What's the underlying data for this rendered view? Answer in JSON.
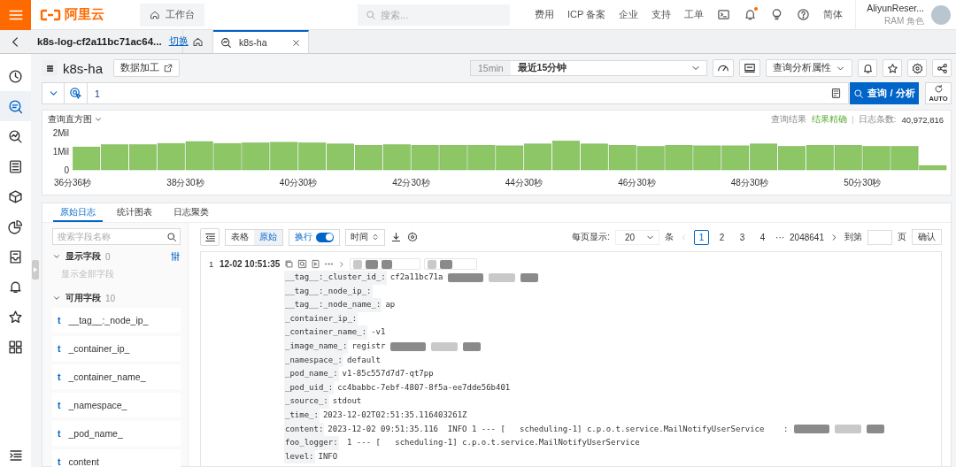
{
  "topbar": {
    "logo": "阿里云",
    "workbench": "工作台",
    "search_placeholder": "搜索...",
    "links": [
      "费用",
      "ICP 备案",
      "企业",
      "支持",
      "工单"
    ],
    "language": "简体",
    "user": {
      "name": "AliyunReser...",
      "role": "RAM 角色"
    }
  },
  "project_bar": {
    "project": "k8s-log-cf2a11bc71ac64...",
    "switch_link": "切换",
    "tabs": [
      {
        "kind": "home",
        "selected": false
      },
      {
        "kind": "logstore",
        "label": "k8s-ha",
        "selected": true
      }
    ]
  },
  "sidebar": {
    "items": [
      {
        "kind": "clock",
        "selected": false
      },
      {
        "kind": "search",
        "selected": true
      },
      {
        "kind": "search-chart",
        "selected": false
      },
      {
        "kind": "list",
        "selected": false
      },
      {
        "kind": "box",
        "selected": false
      },
      {
        "kind": "pie",
        "selected": false
      },
      {
        "kind": "inbox",
        "selected": false
      },
      {
        "kind": "bell",
        "selected": false
      },
      {
        "kind": "star",
        "selected": false
      },
      {
        "kind": "grid",
        "selected": false
      }
    ]
  },
  "logstore": {
    "title": "k8s-ha",
    "data_process_button": "数据加工",
    "time_range": {
      "badge": "15min",
      "label": "最近15分钟"
    },
    "query_properties": "查询分析属性"
  },
  "query": {
    "value": "1",
    "search_button": "查询 / 分析",
    "auto_label": "AUTO"
  },
  "histogram": {
    "title": "查询直方图",
    "result_label": "查询结果",
    "result_status": "结果精确",
    "count_label": "日志条数:",
    "count": "40,972,816",
    "chart_data": {
      "type": "bar",
      "ylim": [
        0,
        2
      ],
      "yticks": [
        0,
        {
          "value": 1,
          "label": "1Mil"
        },
        {
          "value": 2,
          "label": "2Mil"
        }
      ],
      "categories": [
        "36分36秒",
        null,
        null,
        null,
        "38分30秒",
        null,
        null,
        null,
        "40分30秒",
        null,
        null,
        null,
        "42分30秒",
        null,
        null,
        null,
        "44分30秒",
        null,
        null,
        null,
        "46分30秒",
        null,
        null,
        null,
        "48分30秒",
        null,
        null,
        null,
        "50分30秒",
        null,
        null
      ],
      "series": [
        {
          "color": "#8cc665",
          "values": [
            1.23,
            1.35,
            1.35,
            1.42,
            1.52,
            1.42,
            1.45,
            1.48,
            1.45,
            1.39,
            1.32,
            1.35,
            1.32,
            1.32,
            1.32,
            1.29,
            1.39,
            1.55,
            1.39,
            1.32,
            1.26,
            1.32,
            1.29,
            1.29,
            1.39,
            1.26,
            1.32,
            1.32,
            1.26,
            1.26,
            0.23
          ]
        }
      ]
    }
  },
  "result_tabs": [
    {
      "label": "原始日志",
      "selected": true
    },
    {
      "label": "统计图表",
      "selected": false
    },
    {
      "label": "日志聚类",
      "selected": false
    }
  ],
  "fields_panel": {
    "search_placeholder": "搜索字段名称",
    "shown": {
      "label": "显示字段",
      "count": "0",
      "expanded": true
    },
    "show_all": {
      "label": "显示全部字段",
      "disabled": true
    },
    "available": {
      "label": "可用字段",
      "count": "10",
      "expanded": true
    },
    "fields": [
      {
        "type": "t",
        "name": "__tag__:_node_ip_"
      },
      {
        "type": "t",
        "name": "_container_ip_"
      },
      {
        "type": "t",
        "name": "_container_name_"
      },
      {
        "type": "t",
        "name": "_namespace_"
      },
      {
        "type": "t",
        "name": "_pod_name_"
      },
      {
        "type": "t",
        "name": "content"
      }
    ]
  },
  "log_toolbar": {
    "view_modes": [
      {
        "label": "表格",
        "selected": false
      },
      {
        "label": "原始",
        "selected": true
      }
    ],
    "wrap": {
      "label": "换行",
      "on": true
    },
    "sort": "时间"
  },
  "pagination": {
    "per_page_label": "每页显示:",
    "per_page": "20",
    "unit": "条",
    "pages": [
      {
        "label": "1",
        "selected": true
      },
      {
        "label": "2",
        "selected": false
      },
      {
        "label": "3",
        "selected": false
      },
      {
        "label": "4",
        "selected": false
      }
    ],
    "ellipsis": "···",
    "last_page": "2048641",
    "goto_label": "到第",
    "page_unit": "页",
    "confirm": "确认"
  },
  "log_entries": [
    {
      "index": "1",
      "time": "12-02 10:51:35",
      "fields": [
        {
          "key": "__tag__:_cluster_id_:",
          "value": "cf2a11bc71a",
          "redacted": true
        },
        {
          "key": "__tag__:_node_ip_:",
          "redacted": false
        },
        {
          "key": "__tag__:_node_name_:",
          "value": "ap",
          "redacted": false
        },
        {
          "key": "_container_ip_:",
          "redacted": false
        },
        {
          "key": "_container_name_:",
          "value": "-v1",
          "redacted": false
        },
        {
          "key": "_image_name_:",
          "value": "registr",
          "redacted": true
        },
        {
          "key": "_namespace_:",
          "value": "default",
          "redacted": false
        },
        {
          "key": "_pod_name_:",
          "value": "v1-85c557d7d7-qt7pp",
          "redacted": false
        },
        {
          "key": "_pod_uid_:",
          "value": "cc4babbc-7ebf-4807-8f5a-ee7dde56b401",
          "redacted": false
        },
        {
          "key": "_source_:",
          "value": "stdout",
          "redacted": false
        },
        {
          "key": "_time_:",
          "value": "2023-12-02T02:51:35.116403261Z",
          "redacted": false
        },
        {
          "key": "content:",
          "value": "2023-12-02 09:51:35.116  INFO 1 --- [   scheduling-1] c.p.o.t.service.MailNotifyUserService    :",
          "redacted": true
        },
        {
          "key": "foo_logger:",
          "value": " 1 --- [   scheduling-1] c.p.o.t.service.MailNotifyUserService",
          "redacted": false
        },
        {
          "key": "level:",
          "value": "INFO",
          "redacted": false
        }
      ]
    }
  ]
}
